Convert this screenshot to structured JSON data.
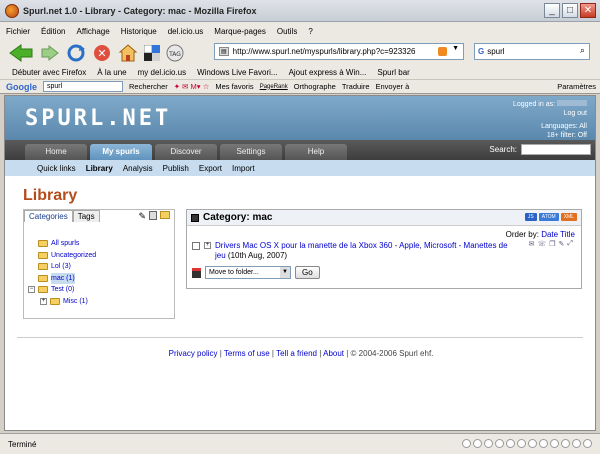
{
  "window": {
    "title": "Spurl.net 1.0 - Library - Category: mac - Mozilla Firefox"
  },
  "menu": [
    "Fichier",
    "Édition",
    "Affichage",
    "Historique",
    "del.icio.us",
    "Marque-pages",
    "Outils",
    "?"
  ],
  "nav": {
    "url": "http://www.spurl.net/myspurls/library.php?c=923326",
    "url_tag": "TAG",
    "search": "spurl"
  },
  "bookmarks": [
    "Débuter avec Firefox",
    "À la une",
    "my del.icio.us",
    "Windows Live Favori...",
    "Ajout express à Win...",
    "Spurl bar"
  ],
  "gtoolbar": {
    "search": "spurl",
    "rechercher": "Rechercher",
    "favoris": "Mes favoris",
    "pagerank": "PageRank",
    "ortho": "Orthographe",
    "traduire": "Traduire",
    "envoyer": "Envoyer à",
    "params": "Paramètres"
  },
  "site": {
    "logo": "SPURL.NET",
    "logged_in": "Logged in as:",
    "logout": "Log out",
    "languages": "Languages: All",
    "filter": "18+ filter: Off",
    "tabs": [
      "Home",
      "My spurls",
      "Discover",
      "Settings",
      "Help"
    ],
    "search_label": "Search:",
    "subnav": [
      "Quick links",
      "Library",
      "Analysis",
      "Publish",
      "Export",
      "Import"
    ]
  },
  "library": {
    "title": "Library",
    "tabs": [
      "Categories",
      "Tags"
    ],
    "tree": [
      {
        "label": "All spurls",
        "indent": 0,
        "expander": ""
      },
      {
        "label": "Uncategorized",
        "indent": 0,
        "expander": ""
      },
      {
        "label": "Lol (3)",
        "indent": 0,
        "expander": ""
      },
      {
        "label": "mac (1)",
        "indent": 0,
        "expander": "",
        "selected": true
      },
      {
        "label": "Test (0)",
        "indent": 0,
        "expander": "−"
      },
      {
        "label": "Misc (1)",
        "indent": 1,
        "expander": "+"
      }
    ],
    "category_heading": "Category: mac",
    "feeds": [
      "JS",
      "ATOM",
      "XML"
    ],
    "order_label": "Order by:",
    "order_date": "Date",
    "order_title": "Title",
    "item_title": "Drivers Mac OS X pour la manette de la Xbox 360 - Apple, Microsoft - Manettes de jeu",
    "item_date": "(10th Aug, 2007)",
    "move_select": "Move to folder...",
    "go": "Go"
  },
  "footer": {
    "links": [
      "Privacy policy",
      "Terms of use",
      "Tell a friend",
      "About"
    ],
    "copyright": "© 2004-2006 Spurl ehf."
  },
  "status": {
    "text": "Terminé"
  }
}
